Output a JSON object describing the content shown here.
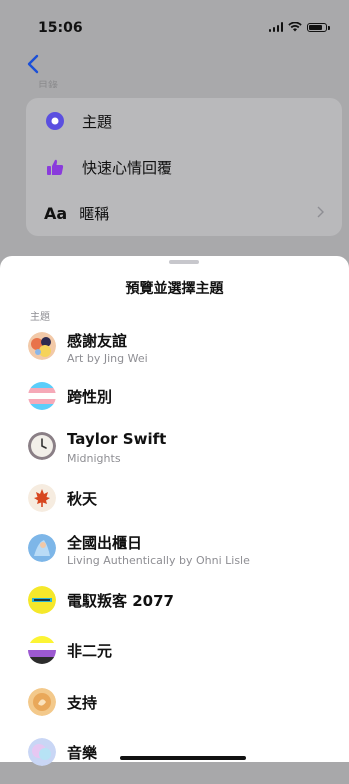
{
  "status_bar": {
    "time": "15:06"
  },
  "background_screen": {
    "cut_off_label": "目錄",
    "settings": [
      {
        "icon": "theme-circle-icon",
        "label": "主題"
      },
      {
        "icon": "thumbs-up-icon",
        "label": "快速心情回覆"
      },
      {
        "icon": "aa-icon",
        "icon_text": "Aa",
        "label": "暱稱"
      }
    ]
  },
  "sheet": {
    "title": "預覽並選擇主題",
    "section_label": "主題",
    "themes": [
      {
        "name": "感謝友誼",
        "subtitle": "Art by Jing Wei",
        "icon": "friendship-art-icon"
      },
      {
        "name": "跨性別",
        "subtitle": "",
        "icon": "trans-flag-icon"
      },
      {
        "name": "Taylor Swift",
        "subtitle": "Midnights",
        "icon": "clock-icon"
      },
      {
        "name": "秋天",
        "subtitle": "",
        "icon": "maple-leaf-icon"
      },
      {
        "name": "全國出櫃日",
        "subtitle": "Living Authentically by Ohni Lisle",
        "icon": "coming-out-art-icon"
      },
      {
        "name": "電馭叛客 2077",
        "subtitle": "",
        "icon": "cyberpunk-logo-icon"
      },
      {
        "name": "非二元",
        "subtitle": "",
        "icon": "nonbinary-flag-icon"
      },
      {
        "name": "支持",
        "subtitle": "",
        "icon": "support-icon"
      },
      {
        "name": "音樂",
        "subtitle": "",
        "icon": "music-icon"
      }
    ]
  },
  "colors": {
    "theme_accent": "#5b4fe0",
    "thumb_purple": "#8a3bdc",
    "cyberpunk_yellow": "#f5e82a"
  }
}
